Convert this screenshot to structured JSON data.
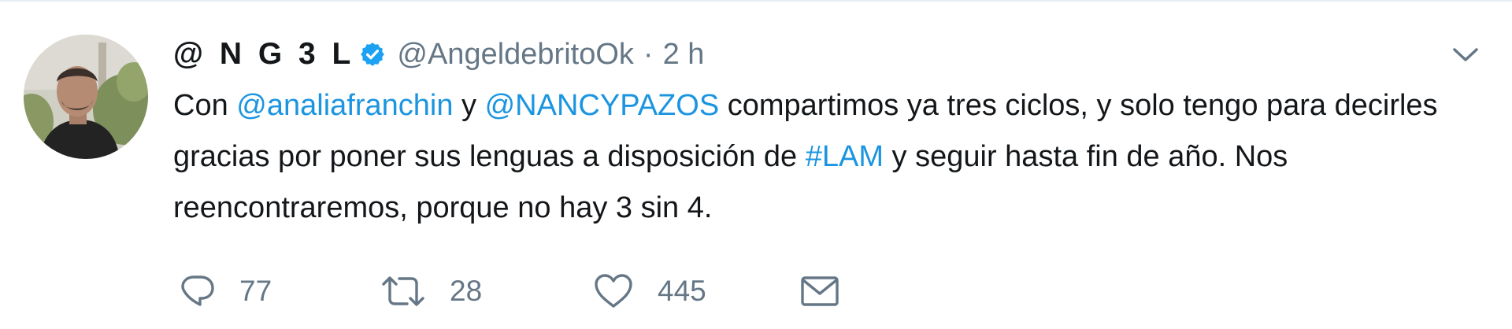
{
  "tweet": {
    "display_name": "@ N G 3 L",
    "verified": true,
    "handle": "@AngeldebritoOk",
    "separator": "·",
    "time": "2 h",
    "text": {
      "t1": "Con ",
      "mention1": "@analiafranchin",
      "t2": " y ",
      "mention2": "@NANCYPAZOS",
      "t3": " compartimos ya tres ciclos, y solo tengo para decirles gracias por poner sus lenguas a disposición de ",
      "hashtag": "#LAM",
      "t4": " y seguir hasta fin de año. Nos reencontraremos, porque no hay 3 sin 4."
    },
    "actions": {
      "reply_count": "77",
      "retweet_count": "28",
      "like_count": "445"
    },
    "colors": {
      "link": "#1b95e0",
      "secondary": "#657786",
      "verified": "#1da1f2"
    }
  }
}
